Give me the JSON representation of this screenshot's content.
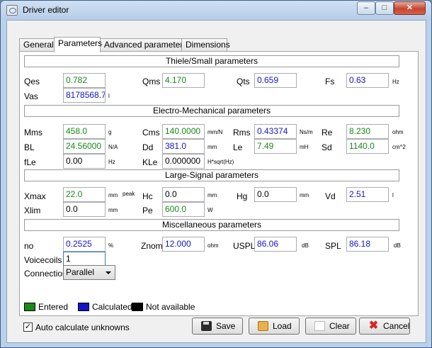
{
  "window": {
    "title": "Driver editor",
    "controls": {
      "minimize": "–",
      "maximize": "□",
      "close": "✕"
    }
  },
  "tabs": [
    {
      "label": "General",
      "active": false
    },
    {
      "label": "Parameters",
      "active": true
    },
    {
      "label": "Advanced parameters",
      "active": false
    },
    {
      "label": "Dimensions",
      "active": false
    }
  ],
  "sections": {
    "thiele_small": "Thiele/Small parameters",
    "electro_mechanical": "Electro-Mechanical parameters",
    "large_signal": "Large-Signal parameters",
    "misc": "Miscellaneous parameters"
  },
  "ts": {
    "qes": {
      "label": "Qes",
      "value": "0.782",
      "unit": ""
    },
    "qms": {
      "label": "Qms",
      "value": "4.170",
      "unit": ""
    },
    "qts": {
      "label": "Qts",
      "value": "0.659",
      "unit": ""
    },
    "fs": {
      "label": "Fs",
      "value": "0.63",
      "unit": "Hz"
    },
    "vas": {
      "label": "Vas",
      "value": "8178568.74",
      "unit": "l"
    }
  },
  "em": {
    "mms": {
      "label": "Mms",
      "value": "458.0",
      "unit": "g"
    },
    "cms": {
      "label": "Cms",
      "value": "140.0000",
      "unit": "mm/N"
    },
    "rms": {
      "label": "Rms",
      "value": "0.43374",
      "unit": "Ns/m"
    },
    "re": {
      "label": "Re",
      "value": "8.230",
      "unit": "ohm"
    },
    "bl": {
      "label": "BL",
      "value": "24.56000",
      "unit": "N/A"
    },
    "dd": {
      "label": "Dd",
      "value": "381.0",
      "unit": "mm"
    },
    "le": {
      "label": "Le",
      "value": "7.49",
      "unit": "mH"
    },
    "sd": {
      "label": "Sd",
      "value": "1140.0",
      "unit": "cm^2"
    },
    "fle": {
      "label": "fLe",
      "value": "0.00",
      "unit": "Hz"
    },
    "kle": {
      "label": "KLe",
      "value": "0.000000",
      "unit": "H*sqrt(Hz)"
    }
  },
  "ls": {
    "xmax": {
      "label": "Xmax",
      "value": "22.0",
      "unit": "mm",
      "unit2": "peak"
    },
    "hc": {
      "label": "Hc",
      "value": "0.0",
      "unit": "mm"
    },
    "hg": {
      "label": "Hg",
      "value": "0.0",
      "unit": "mm"
    },
    "vd": {
      "label": "Vd",
      "value": "2.51",
      "unit": "l"
    },
    "xlim": {
      "label": "Xlim",
      "value": "0.0",
      "unit": "mm"
    },
    "pe": {
      "label": "Pe",
      "value": "600.0",
      "unit": "W"
    }
  },
  "misc": {
    "no": {
      "label": "no",
      "value": "0.2525",
      "unit": "%"
    },
    "znom": {
      "label": "Znom",
      "value": "12.000",
      "unit": "ohm"
    },
    "uspl": {
      "label": "USPL",
      "value": "86.06",
      "unit": "dB"
    },
    "spl": {
      "label": "SPL",
      "value": "86.18",
      "unit": "dB"
    },
    "voicecoils": {
      "label": "Voicecoils",
      "value": "1"
    },
    "connection": {
      "label": "Connection",
      "value": "Parallel"
    }
  },
  "legend": {
    "entered": {
      "label": "Entered",
      "color": "#178a17"
    },
    "calculated": {
      "label": "Calculated",
      "color": "#1414c8"
    },
    "not_available": {
      "label": "Not available",
      "color": "#000000"
    }
  },
  "auto_calc": {
    "label": "Auto calculate unknowns",
    "checked": true,
    "mark": "✓"
  },
  "buttons": {
    "save": "Save",
    "load": "Load",
    "clear": "Clear",
    "cancel": "Cancel",
    "cancel_icon": "✖"
  },
  "colors": {
    "entered": "#178a17",
    "calculated": "#1414c8",
    "not_available": "#000000"
  }
}
